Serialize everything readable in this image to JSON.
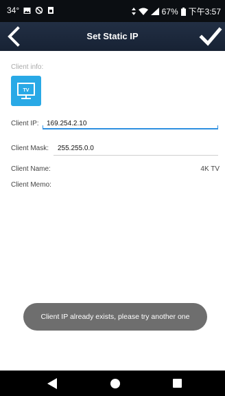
{
  "status_bar": {
    "temperature": "34°",
    "battery_percent": "67%",
    "time": "下午3:57",
    "icons": [
      "image-icon",
      "sync-disabled-icon",
      "save-icon",
      "data-arrows-icon",
      "wifi-icon",
      "signal-icon",
      "battery-icon"
    ]
  },
  "header": {
    "title": "Set Static IP",
    "back_icon": "back-chevron-icon",
    "confirm_icon": "checkmark-icon"
  },
  "client": {
    "info_label": "Client info:",
    "device_icon": "tv-icon",
    "device_icon_text": "TV",
    "ip_label": "Client IP:",
    "ip_value": "169.254.2.10",
    "mask_label": "Client Mask:",
    "mask_value": "255.255.0.0",
    "name_label": "Client Name:",
    "name_value": "4K TV",
    "memo_label": "Client Memo:"
  },
  "toast": {
    "message": "Client IP already exists, please try another one"
  },
  "nav_bar": {
    "icons": [
      "nav-back-icon",
      "nav-home-icon",
      "nav-recents-icon"
    ]
  },
  "colors": {
    "header_bg": "#1c283b",
    "accent_blue": "#2e8fe0",
    "tv_icon_bg": "#29a9e6",
    "toast_bg": "#6e6e6e"
  }
}
